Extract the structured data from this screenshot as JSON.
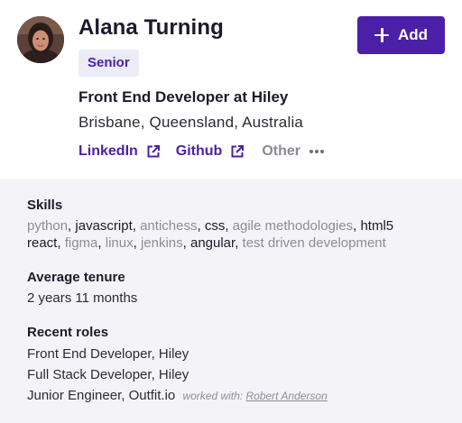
{
  "profile": {
    "name": "Alana Turning",
    "badge": "Senior",
    "title": "Front End Developer at Hiley",
    "location": "Brisbane, Queensland, Australia"
  },
  "add_button": {
    "label": "Add",
    "icon": "plus-icon"
  },
  "links": [
    {
      "label": "LinkedIn",
      "icon": "external-link-icon"
    },
    {
      "label": "Github",
      "icon": "external-link-icon"
    }
  ],
  "other": {
    "label": "Other",
    "icon": "more-dots-icon"
  },
  "skills": {
    "heading": "Skills",
    "line1": [
      {
        "text": "python",
        "highlight": false
      },
      {
        "text": "javascript",
        "highlight": true
      },
      {
        "text": "antichess",
        "highlight": false
      },
      {
        "text": "css",
        "highlight": true
      },
      {
        "text": "agile methodologies",
        "highlight": false
      },
      {
        "text": "html5",
        "highlight": true
      }
    ],
    "line2": [
      {
        "text": "react",
        "highlight": true
      },
      {
        "text": "figma",
        "highlight": false
      },
      {
        "text": "linux",
        "highlight": false
      },
      {
        "text": "jenkins",
        "highlight": false
      },
      {
        "text": "angular",
        "highlight": true
      },
      {
        "text": "test driven development",
        "highlight": false
      }
    ]
  },
  "tenure": {
    "heading": "Average tenure",
    "value": "2 years 11 months"
  },
  "recent_roles": {
    "heading": "Recent roles",
    "roles": [
      "Front End Developer, Hiley",
      "Full Stack Developer, Hiley",
      "Junior Engineer, Outfit.io"
    ],
    "worked_with_label": "worked with:",
    "worked_with_person": "Robert Anderson"
  },
  "colors": {
    "accent": "#4b1fa8",
    "badge_bg": "#ecebf8",
    "panel_bg": "#f4f4f8"
  }
}
